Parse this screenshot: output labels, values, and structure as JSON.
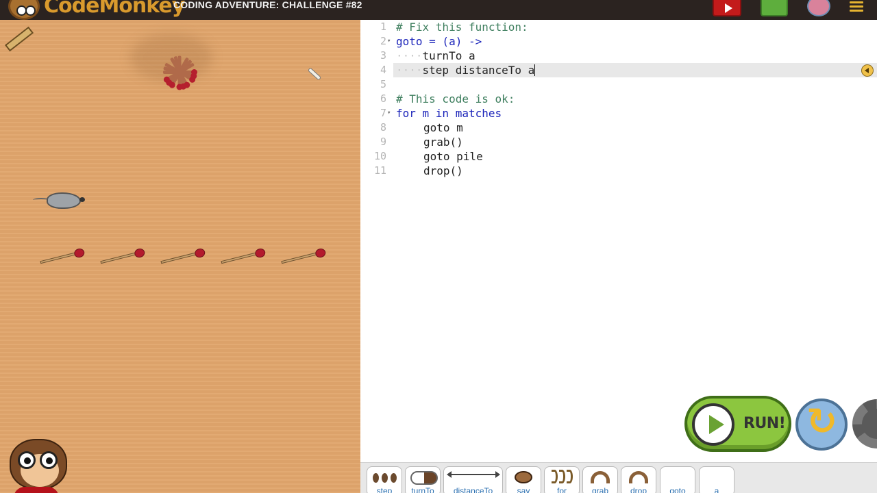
{
  "header": {
    "logo_text": "CodeMonkey",
    "title": "CODING ADVENTURE: CHALLENGE #82"
  },
  "icons": {
    "video": "play-video-icon",
    "map": "map-icon",
    "avatar": "avatar-icon",
    "menu": "hamburger-menu-icon"
  },
  "editor": {
    "lines": [
      {
        "num": "1",
        "text": "# Fix this function:"
      },
      {
        "num": "2",
        "text": "goto = (a) ->"
      },
      {
        "num": "3",
        "text": "turnTo a"
      },
      {
        "num": "4",
        "text": "step distanceTo a"
      },
      {
        "num": "5",
        "text": ""
      },
      {
        "num": "6",
        "text": "# This code is ok:"
      },
      {
        "num": "7",
        "text": "for m in matches"
      },
      {
        "num": "8",
        "text": "goto m"
      },
      {
        "num": "9",
        "text": "grab()"
      },
      {
        "num": "10",
        "text": "goto pile"
      },
      {
        "num": "11",
        "text": "drop()"
      }
    ]
  },
  "controls": {
    "run_label": "RUN!"
  },
  "toolbox": {
    "items": [
      "step",
      "turnTo",
      "distanceTo",
      "say",
      "for",
      "grab",
      "drop",
      "goto",
      "a"
    ]
  },
  "colors": {
    "topbar": "#2b2320",
    "game_background": "#e0a56c",
    "run_button": "#8cc63f",
    "comment": "#3f7f5f",
    "keyword": "#1a23b9"
  }
}
